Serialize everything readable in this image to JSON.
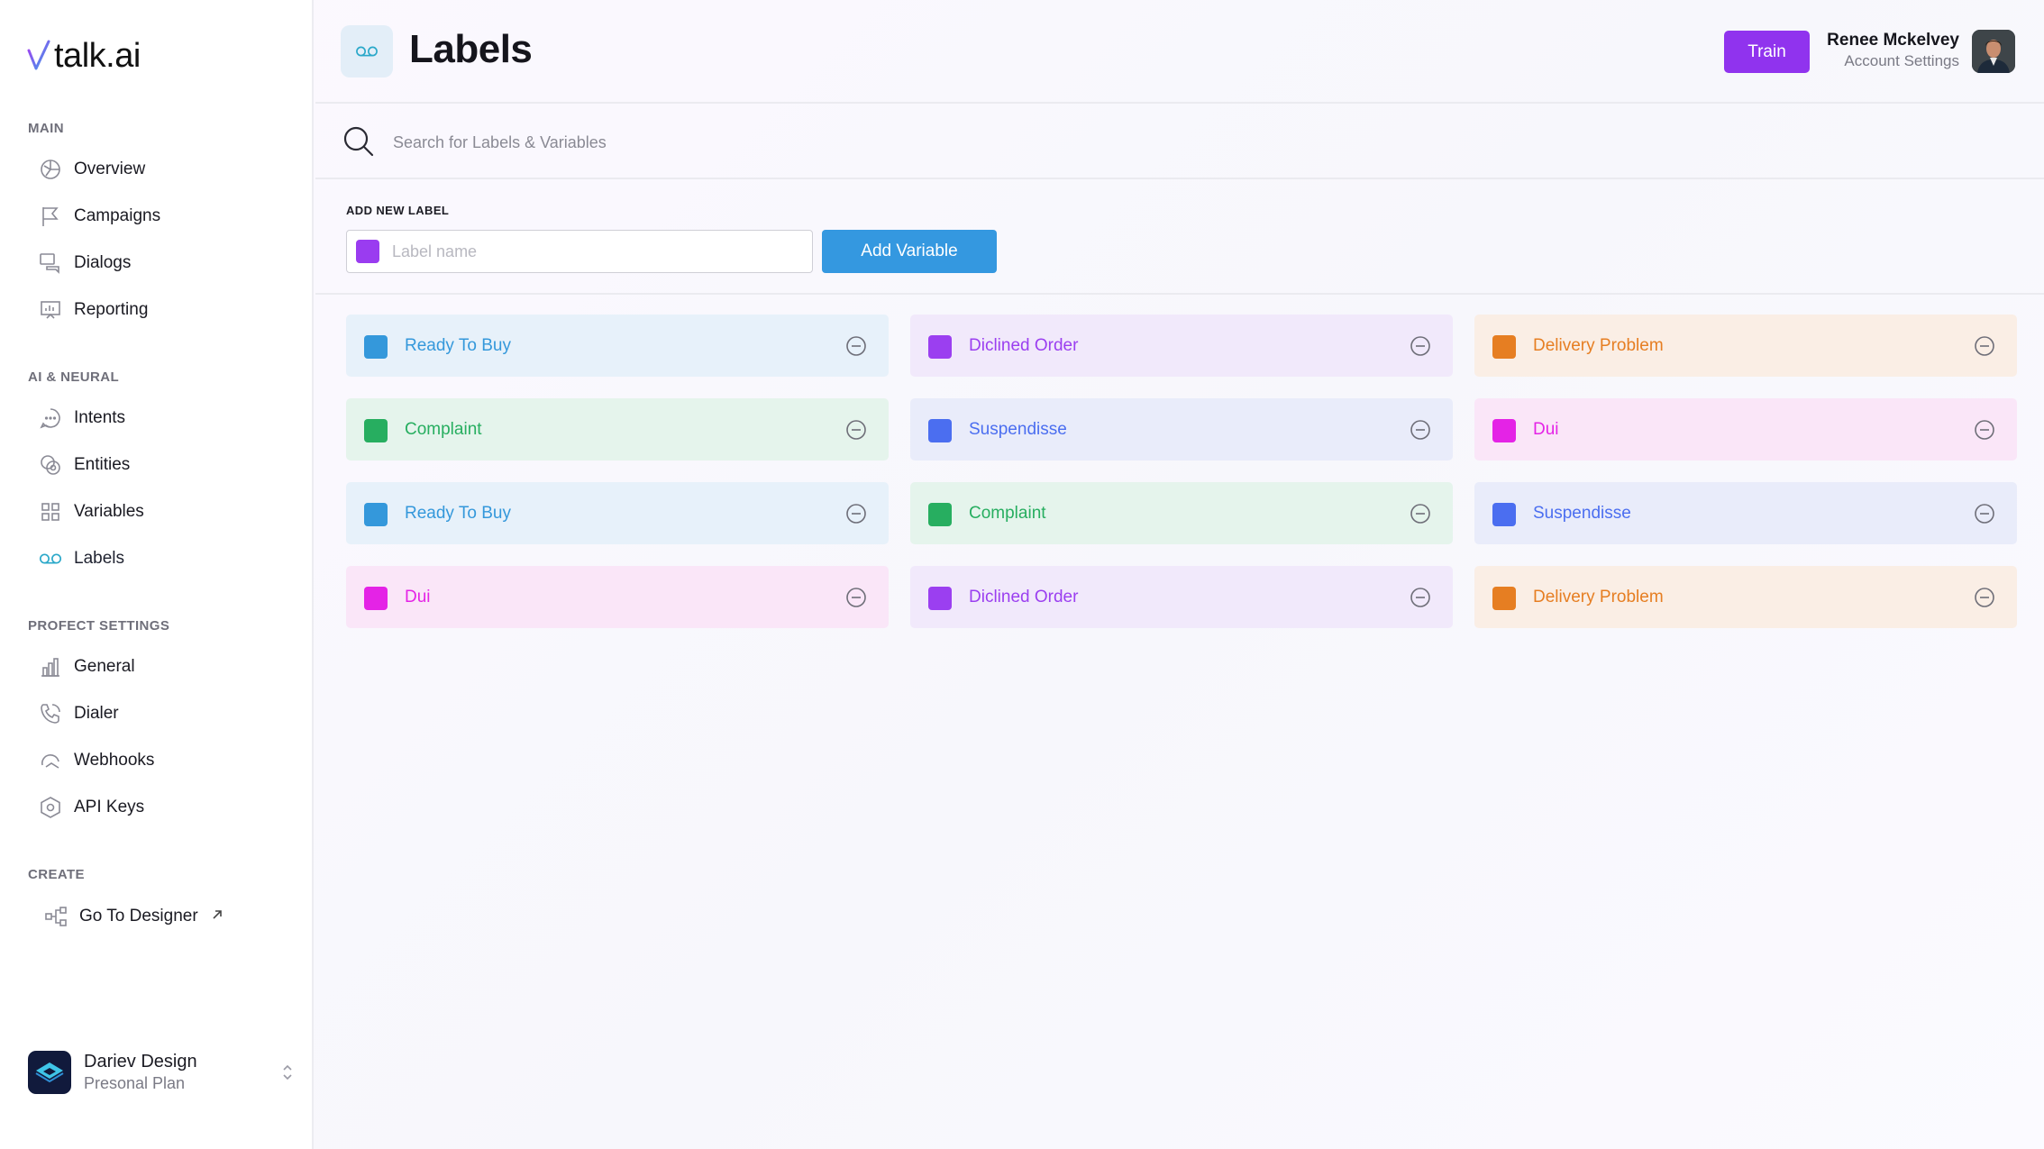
{
  "app": {
    "logo_text": "talk.ai"
  },
  "sidebar": {
    "sections": [
      {
        "title": "MAIN"
      },
      {
        "title": "AI & NEURAL"
      },
      {
        "title": "PROFECT SETTINGS"
      },
      {
        "title": "CREATE"
      }
    ],
    "items": [
      {
        "label": "Overview",
        "icon": "pie-chart-icon"
      },
      {
        "label": "Campaigns",
        "icon": "flag-icon"
      },
      {
        "label": "Dialogs",
        "icon": "chat-bubbles-icon"
      },
      {
        "label": "Reporting",
        "icon": "presentation-chart-icon"
      },
      {
        "label": "Intents",
        "icon": "chat-dots-icon"
      },
      {
        "label": "Entities",
        "icon": "entities-icon"
      },
      {
        "label": "Variables",
        "icon": "grid-icon"
      },
      {
        "label": "Labels",
        "icon": "voicemail-icon",
        "active": true
      },
      {
        "label": "General",
        "icon": "bar-chart-icon"
      },
      {
        "label": "Dialer",
        "icon": "phone-icon"
      },
      {
        "label": "Webhooks",
        "icon": "webhook-icon"
      },
      {
        "label": "API Keys",
        "icon": "hexagon-icon"
      },
      {
        "label": "Go To Designer",
        "icon": "flow-icon",
        "external": true
      }
    ],
    "workspace": {
      "name": "Dariev Design",
      "plan": "Presonal Plan"
    }
  },
  "header": {
    "title": "Labels",
    "train_label": "Train",
    "user_name": "Renee Mckelvey",
    "user_sub": "Account Settings"
  },
  "search": {
    "placeholder": "Search for Labels & Variables"
  },
  "add_label": {
    "title": "ADD NEW LABEL",
    "placeholder": "Label name",
    "swatch_color": "#9a3cf0",
    "button_label": "Add Variable"
  },
  "labels": [
    {
      "name": "Ready To Buy",
      "color": "#3498db",
      "bg": "#e7f1fa"
    },
    {
      "name": "Diclined Order",
      "color": "#9b3ff0",
      "bg": "#f1e9fb"
    },
    {
      "name": "Delivery Problem",
      "color": "#e67e22",
      "bg": "#faeee5"
    },
    {
      "name": "Complaint",
      "color": "#27ae60",
      "bg": "#e5f4ec"
    },
    {
      "name": "Suspendisse",
      "color": "#4b6ef0",
      "bg": "#e9ecfa"
    },
    {
      "name": "Dui",
      "color": "#e423e6",
      "bg": "#fae6f8"
    },
    {
      "name": "Ready To Buy",
      "color": "#3498db",
      "bg": "#e7f1fa"
    },
    {
      "name": "Complaint",
      "color": "#27ae60",
      "bg": "#e5f4ec"
    },
    {
      "name": "Suspendisse",
      "color": "#4b6ef0",
      "bg": "#e9ecfa"
    },
    {
      "name": "Dui",
      "color": "#e423e6",
      "bg": "#fae6f8"
    },
    {
      "name": "Diclined Order",
      "color": "#9b3ff0",
      "bg": "#f1e9fb"
    },
    {
      "name": "Delivery Problem",
      "color": "#e67e22",
      "bg": "#faeee5"
    }
  ]
}
